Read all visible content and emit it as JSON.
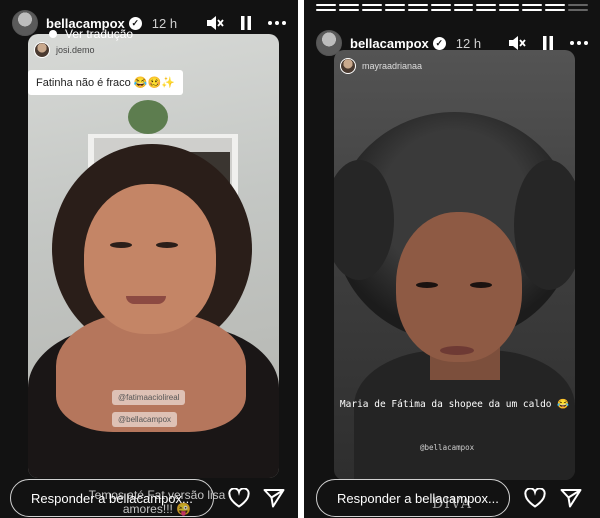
{
  "left_story": {
    "username": "bellacampox",
    "verified_mark": "✓",
    "time": "12 h",
    "translate_label": "Ver tradução",
    "repost_username": "josi.demo",
    "caption": "Fatinha não é fraco 😂🥴✨",
    "mention_1": "@fatimaaciolireal",
    "mention_2": "@bellacampox",
    "overlay_text": "Temos até Fat versão lisa amores!!! 😜",
    "reply_placeholder": "Responder a bellacampox..."
  },
  "right_story": {
    "username": "bellacampox",
    "verified_mark": "✓",
    "time": "12 h",
    "repost_username": "mayraadrianaa",
    "caption": "Maria de Fátima da shopee da um caldo 😂",
    "mention": "@bellacampox",
    "reply_placeholder": "Responder a bellacampox...",
    "watermark": "DIVA"
  },
  "icons": [
    "mute-icon",
    "pause-icon",
    "more-icon",
    "heart-icon",
    "send-icon"
  ],
  "colors": {
    "background": "#121212",
    "text": "#ffffff"
  }
}
